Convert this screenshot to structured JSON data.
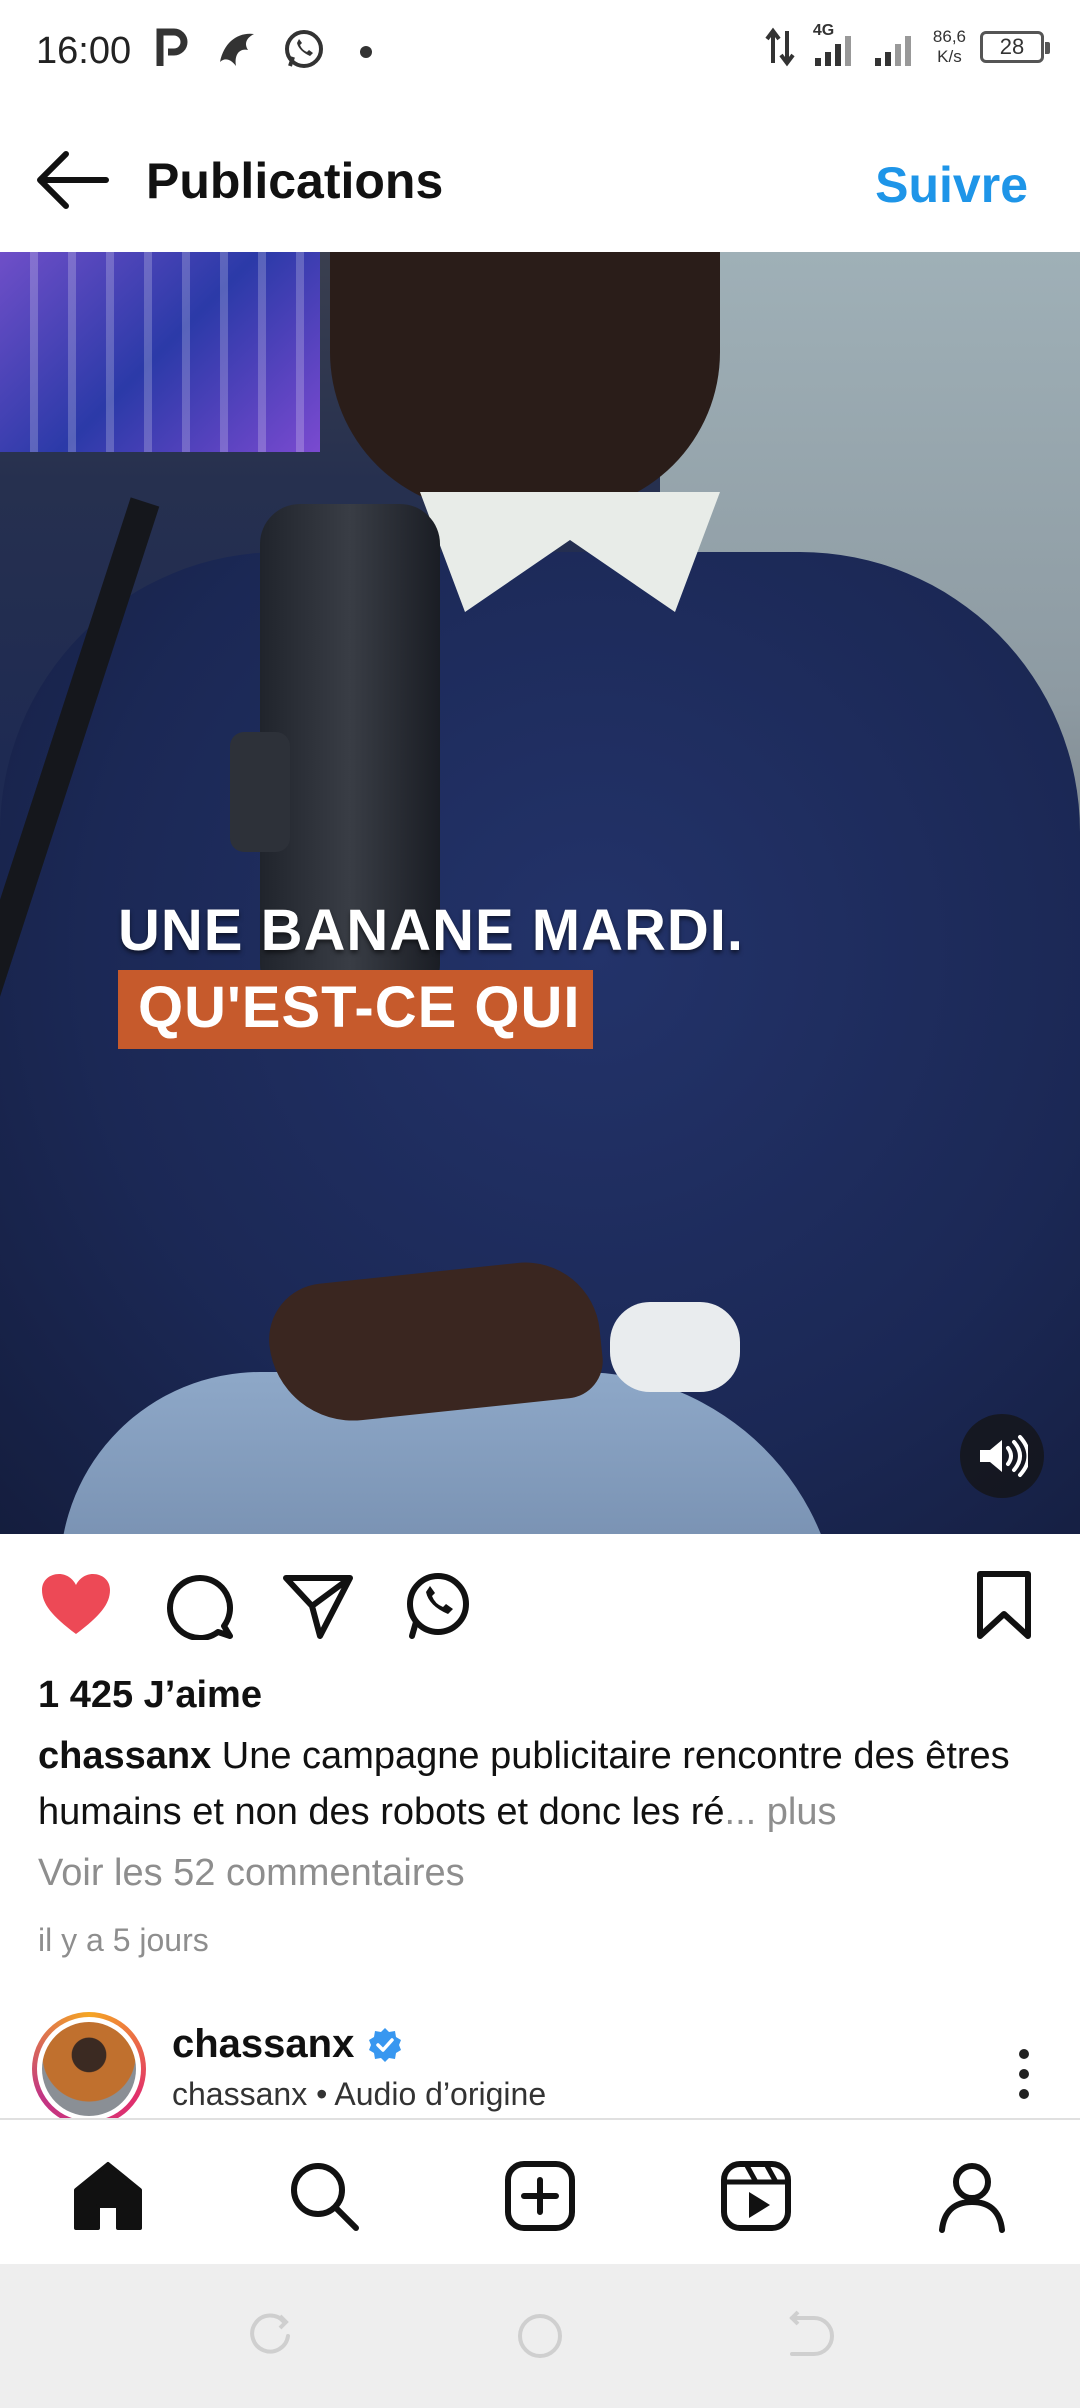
{
  "status_bar": {
    "time": "16:00",
    "network": "4G",
    "speed_value": "86,6",
    "speed_unit": "K/s",
    "battery": "28",
    "icons": [
      "parking-icon",
      "bird-icon",
      "whatsapp-icon",
      "dot-icon",
      "data-arrows-icon",
      "signal-icon",
      "signal-icon"
    ]
  },
  "header": {
    "title": "Publications",
    "follow_label": "Suivre",
    "accent_color": "#1e95e8"
  },
  "media": {
    "caption_line1": "UNE BANANE MARDI.",
    "caption_line2": "QU'EST-CE QUI",
    "caption_highlight_color": "#c65a2c"
  },
  "actions": {
    "icons": [
      "heart-icon",
      "comment-icon",
      "share-icon",
      "whatsapp-icon",
      "bookmark-icon"
    ],
    "liked_color": "#ed4956"
  },
  "post": {
    "likes": "1 425 J’aime",
    "username": "chassanx",
    "caption_text": " Une campagne publicitaire rencontre des êtres humains et non des robots et donc les ré",
    "more_label": "... plus",
    "view_comments": "Voir les 52 commentaires",
    "time_ago": "il y a 5 jours"
  },
  "next_post": {
    "username": "chassanx",
    "subtitle": "chassanx • Audio d’origine"
  },
  "bottom_nav": {
    "items": [
      "home-icon",
      "search-icon",
      "create-icon",
      "reels-icon",
      "profile-icon"
    ]
  }
}
